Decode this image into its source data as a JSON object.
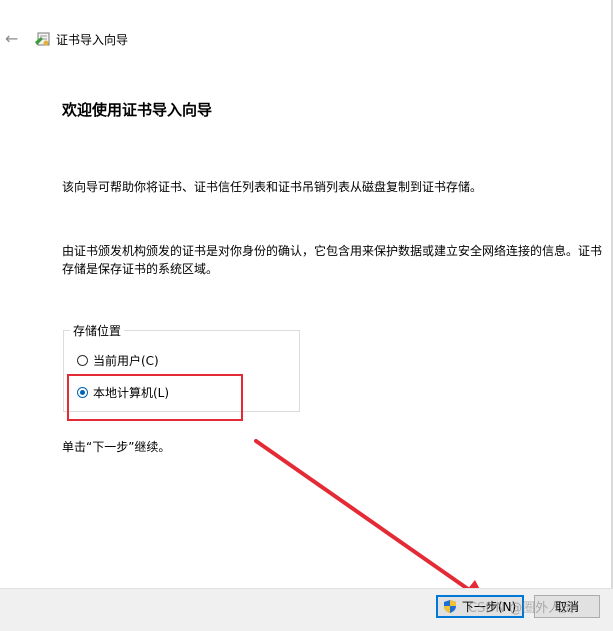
{
  "window": {
    "title": "证书导入向导"
  },
  "page": {
    "heading": "欢迎使用证书导入向导",
    "description": "该向导可帮助你将证书、证书信任列表和证书吊销列表从磁盘复制到证书存储。",
    "explanation": "由证书颁发机构颁发的证书是对你身份的确认，它包含用来保护数据或建立安全网络连接的信息。证书存储是保存证书的系统区域。"
  },
  "store_location": {
    "legend": "存储位置",
    "options": [
      {
        "label": "当前用户(C)",
        "selected": false
      },
      {
        "label": "本地计算机(L)",
        "selected": true
      }
    ]
  },
  "hint": "单击“下一步”继续。",
  "buttons": {
    "next": "下一步(N)",
    "cancel": "取消"
  },
  "watermark": "CSDN @圈外人员",
  "colors": {
    "annotation": "#e32a35",
    "accent": "#0078d7"
  }
}
